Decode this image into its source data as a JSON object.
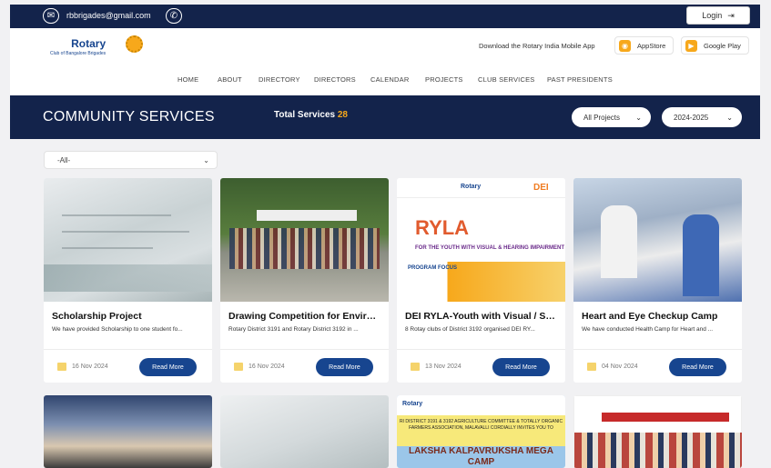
{
  "topbar": {
    "email": "rbbrigades@gmail.com",
    "login_label": "Login"
  },
  "header": {
    "logo_name": "Rotary",
    "logo_club": "Club of Bangalore Brigades",
    "download_text": "Download the Rotary India Mobile App",
    "appstore_label": "AppStore",
    "googleplay_label": "Google Play"
  },
  "nav": {
    "items": [
      "HOME",
      "ABOUT",
      "DIRECTORY",
      "DIRECTORS",
      "CALENDAR",
      "PROJECTS",
      "CLUB SERVICES",
      "PAST PRESIDENTS"
    ]
  },
  "banner": {
    "title": "COMMUNITY SERVICES",
    "total_label": "Total Services",
    "total_count": "28",
    "projects_filter": "All Projects",
    "year_filter": "2024-2025"
  },
  "filter": {
    "value": "-All-"
  },
  "cards": [
    {
      "title": "Scholarship Project",
      "desc": "We have provided Scholarship to one student fo...",
      "date": "16 Nov 2024",
      "button": "Read More"
    },
    {
      "title": "Drawing Competition for Environ...",
      "desc": "Rotary District 3191 and Rotary District 3192 in ...",
      "date": "16 Nov 2024",
      "button": "Read More"
    },
    {
      "title": "DEI RYLA-Youth with Visual / Sp...",
      "desc": "8 Rotay clubs of District 3192 organised DEI RY...",
      "date": "13 Nov 2024",
      "button": "Read More",
      "image_text": {
        "rotary": "Rotary",
        "dei": "DEI",
        "ryla": "RYLA",
        "sub": "FOR THE YOUTH WITH VISUAL & HEARING IMPAIRMENT",
        "program": "PROGRAM FOCUS"
      }
    },
    {
      "title": "Heart and Eye Checkup Camp",
      "desc": "We have conducted Health Camp for Heart and ...",
      "date": "04 Nov 2024",
      "button": "Read More"
    }
  ],
  "row2": {
    "laksha_rotary": "Rotary",
    "laksha_invite": "RI DISTRICT 3191 & 3192 AGRICULTURE COMMITTEE & TOTALLY ORGANIC FARMERS ASSOCIATION, MALAVALLI CORDIALLY INVITES YOU TO",
    "laksha_title": "LAKSHA KALPAVRUKSHA MEGA CAMP"
  },
  "colors": {
    "navy": "#13234b",
    "rotary_blue": "#17458f",
    "gold": "#f7a81b"
  }
}
